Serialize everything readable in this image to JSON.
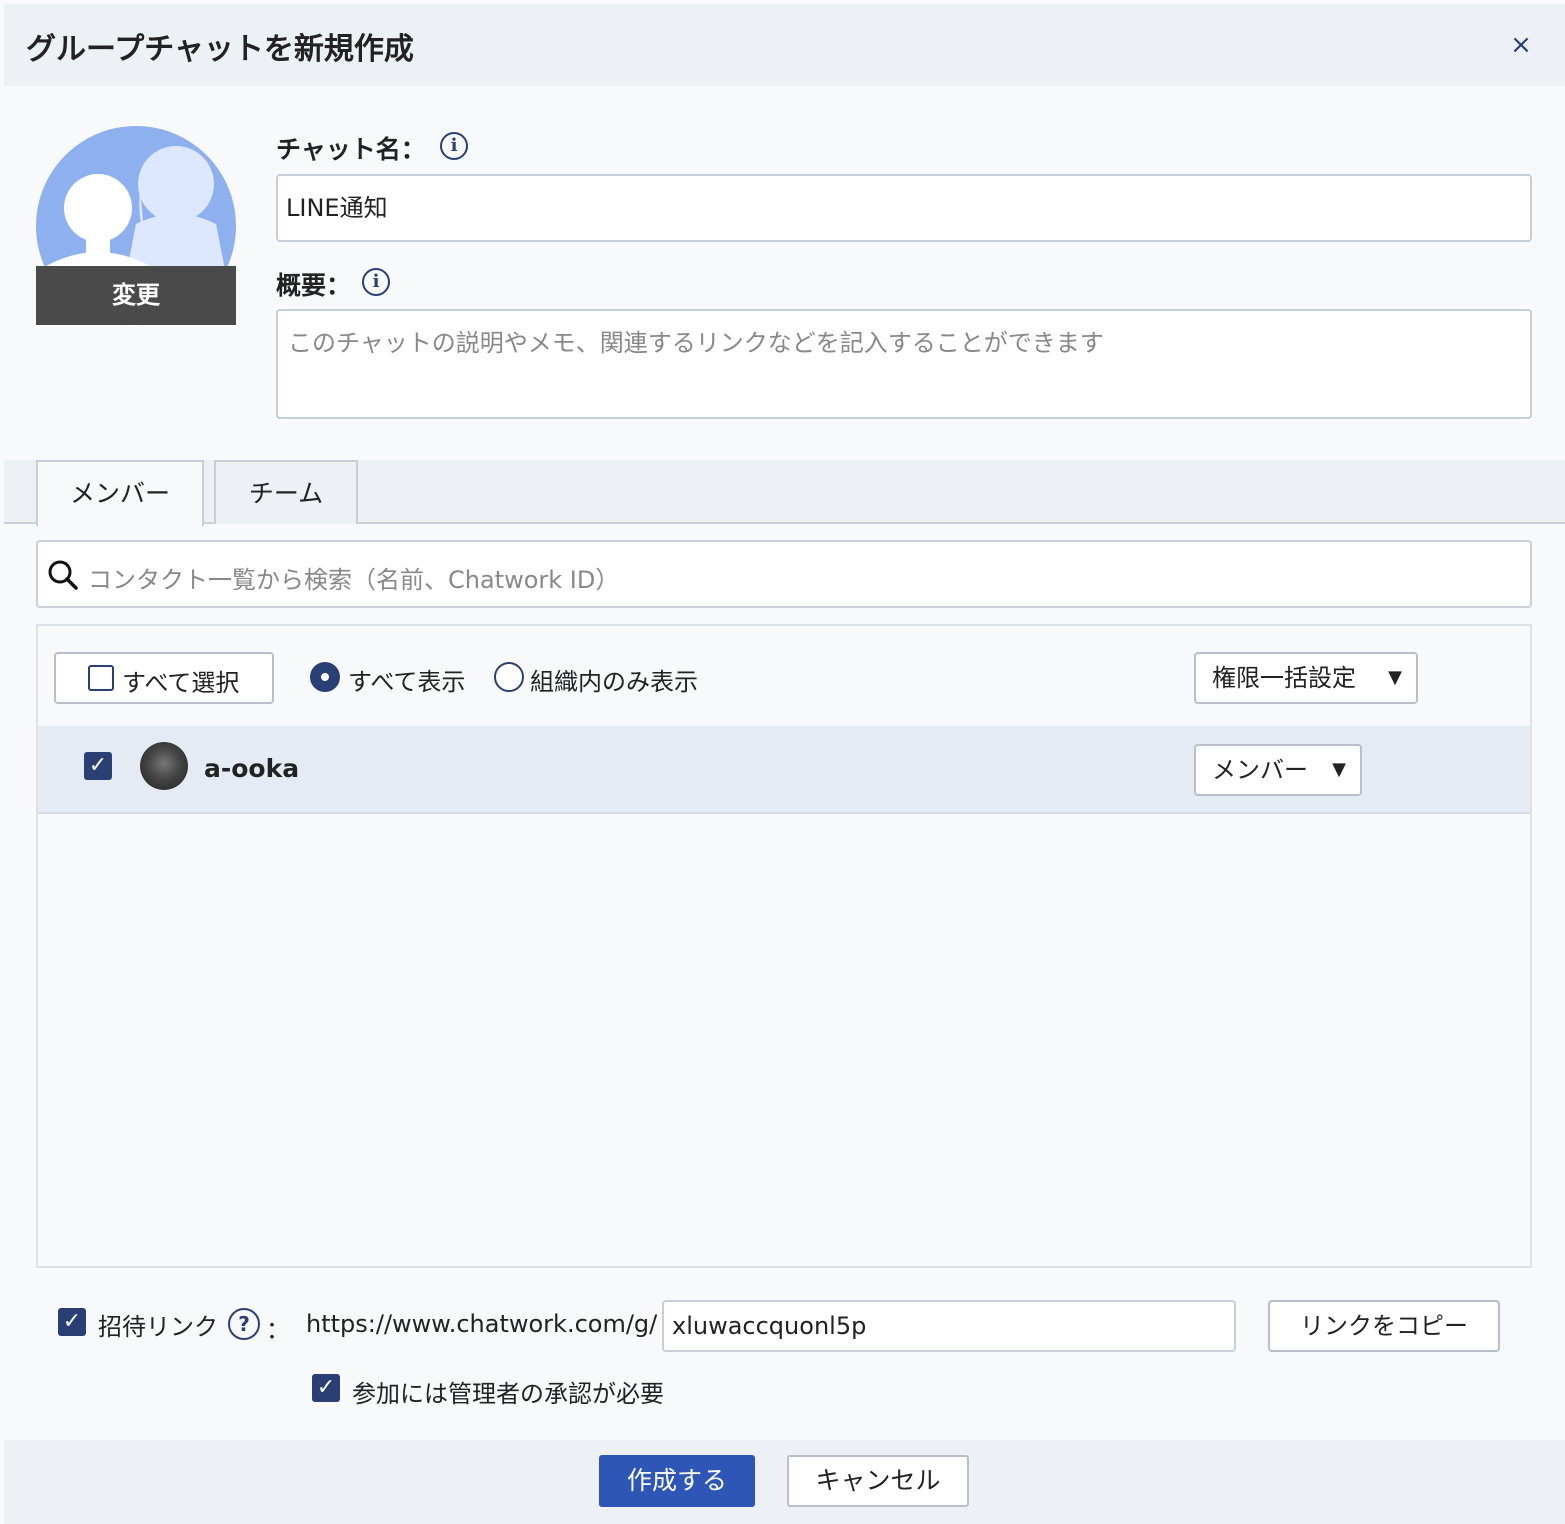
{
  "dialog": {
    "title": "グループチャットを新規作成",
    "close_glyph": "×"
  },
  "avatar": {
    "change_label": "変更",
    "icon": "group-silhouette-icon"
  },
  "chat_name": {
    "label": "チャット名：",
    "value": "LINE通知"
  },
  "summary": {
    "label": "概要：",
    "placeholder": "このチャットの説明やメモ、関連するリンクなどを記入することができます"
  },
  "tabs": [
    {
      "label": "メンバー",
      "active": true
    },
    {
      "label": "チーム",
      "active": false
    }
  ],
  "search": {
    "placeholder": "コンタクト一覧から検索（名前、Chatwork ID）"
  },
  "member_controls": {
    "select_all": "すべて選択",
    "filter_all": "すべて表示",
    "filter_org": "組織内のみ表示",
    "bulk_permission": "権限一括設定"
  },
  "members": [
    {
      "name": "a-ooka",
      "checked": true,
      "role": "メンバー"
    }
  ],
  "invite": {
    "label": "招待リンク",
    "colon": "：",
    "checked": true,
    "url_prefix": "https://www.chatwork.com/g/",
    "url_code": "xluwaccquonl5p",
    "copy_button": "リンクをコピー",
    "approval_label": "参加には管理者の承認が必要",
    "approval_checked": true
  },
  "footer": {
    "create_button": "作成する",
    "cancel_button": "キャンセル"
  },
  "colors": {
    "accent": "#2e56b7",
    "navy": "#2a3f74",
    "avatar_bg": "#8fb0ef",
    "header_bg": "#edf0f4"
  }
}
